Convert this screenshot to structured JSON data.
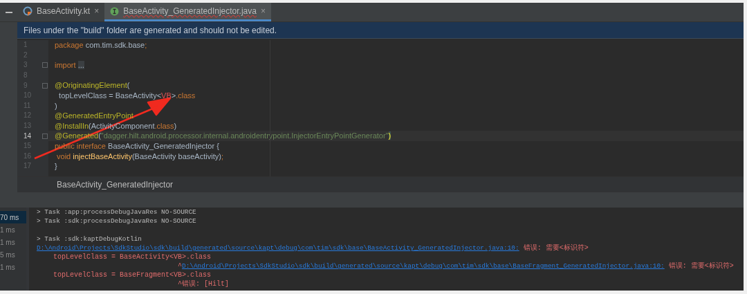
{
  "tabs": [
    {
      "label": "BaseActivity.kt",
      "kind": "kotlin",
      "selected": false,
      "error": false,
      "close": "×"
    },
    {
      "label": "BaseActivity_GeneratedInjector.java",
      "kind": "interface",
      "selected": true,
      "error": true,
      "close": "×"
    }
  ],
  "banner": "Files under the \"build\" folder are generated and should not be edited.",
  "code_lines": [
    {
      "number": "1",
      "fold": false,
      "current": false,
      "tokens": [
        {
          "text": "package ",
          "kind": "keyword"
        },
        {
          "text": "com.tim.sdk.base",
          "kind": "plain"
        },
        {
          "text": ";",
          "kind": "keyword"
        }
      ]
    },
    {
      "number": "2",
      "fold": false,
      "current": false
    },
    {
      "number": "3",
      "fold": true,
      "current": false,
      "tokens": [
        {
          "text": "import ",
          "kind": "keyword"
        },
        {
          "text": "...",
          "kind": "folded"
        }
      ]
    },
    {
      "number": "8",
      "fold": false,
      "current": false
    },
    {
      "number": "9",
      "fold": true,
      "current": false,
      "tokens": [
        {
          "text": "@OriginatingElement",
          "kind": "annotation"
        },
        {
          "text": "(",
          "kind": "plain"
        }
      ]
    },
    {
      "number": "10",
      "fold": false,
      "current": false,
      "tokens": [
        {
          "text": "  topLevelClass = BaseActivity<",
          "kind": "plain"
        },
        {
          "text": "VB",
          "kind": "error"
        },
        {
          "text": ">",
          "kind": "plain"
        },
        {
          "text": ".class",
          "kind": "keyword"
        }
      ]
    },
    {
      "number": "11",
      "fold": false,
      "current": false,
      "tokens": [
        {
          "text": ")",
          "kind": "plain"
        }
      ]
    },
    {
      "number": "12",
      "fold": false,
      "current": false,
      "tokens": [
        {
          "text": "@GeneratedEntryPoint",
          "kind": "annotation"
        }
      ]
    },
    {
      "number": "13",
      "fold": false,
      "current": false,
      "tokens": [
        {
          "text": "@InstallIn",
          "kind": "annotation"
        },
        {
          "text": "(ActivityComponent",
          "kind": "plain"
        },
        {
          "text": ".class",
          "kind": "keyword"
        },
        {
          "text": ")",
          "kind": "plain"
        }
      ]
    },
    {
      "number": "14",
      "fold": true,
      "current": true,
      "tokens": [
        {
          "text": "@Generated",
          "kind": "annotation"
        },
        {
          "text": "(",
          "kind": "plain"
        },
        {
          "text": "\"dagger.hilt.android.processor.internal.androidentrypoint.InjectorEntryPointGenerator\"",
          "kind": "string"
        },
        {
          "text": ")",
          "kind": "brace"
        }
      ]
    },
    {
      "number": "15",
      "fold": false,
      "current": false,
      "tokens": [
        {
          "text": "public interface ",
          "kind": "keyword"
        },
        {
          "text": "BaseActivity_GeneratedInjector {",
          "kind": "plain"
        }
      ]
    },
    {
      "number": "16",
      "fold": false,
      "current": false,
      "tokens": [
        {
          "text": " void ",
          "kind": "keyword"
        },
        {
          "text": "injectBaseActivity",
          "kind": "method"
        },
        {
          "text": "(BaseActivity baseActivity)",
          "kind": "plain"
        },
        {
          "text": ";",
          "kind": "keyword"
        }
      ]
    },
    {
      "number": "17",
      "fold": false,
      "current": false,
      "tokens": [
        {
          "text": "}",
          "kind": "plain"
        }
      ]
    }
  ],
  "breadcrumb": "BaseActivity_GeneratedInjector",
  "build_times": [
    {
      "text": "70 ms",
      "selected": true
    },
    {
      "text": "1 ms",
      "selected": false
    },
    {
      "text": "1 ms",
      "selected": false
    },
    {
      "text": "5 ms",
      "selected": false
    },
    {
      "text": "1 ms",
      "selected": false
    }
  ],
  "console_lines": [
    {
      "tokens": [
        {
          "text": "> Task :app:processDebugJavaRes NO-SOURCE",
          "kind": "plain"
        }
      ]
    },
    {
      "tokens": [
        {
          "text": "> Task :sdk:processDebugJavaRes NO-SOURCE",
          "kind": "plain"
        }
      ]
    },
    {
      "kind": "blank"
    },
    {
      "tokens": [
        {
          "text": "> Task :sdk:kaptDebugKotlin",
          "kind": "plain"
        }
      ]
    },
    {
      "tokens": [
        {
          "text": "D:\\Android\\Projects\\SdkStudio\\sdk\\build\\generated\\source\\kapt\\debug\\com\\tim\\sdk\\base\\BaseActivity_GeneratedInjector.java:10:",
          "kind": "link"
        },
        {
          "text": " 错误: 需要<标识符>",
          "kind": "error"
        }
      ]
    },
    {
      "tokens": [
        {
          "text": "    topLevelClass = BaseActivity<VB>.class",
          "kind": "error"
        }
      ]
    },
    {
      "tokens": [
        {
          "text": "                                  ^",
          "kind": "error"
        },
        {
          "text": "D:\\Android\\Projects\\SdkStudio\\sdk\\build\\generated\\source\\kapt\\debug\\com\\tim\\sdk\\base\\BaseFragment_GeneratedInjector.java:10:",
          "kind": "link"
        },
        {
          "text": " 错误: 需要<标识符>",
          "kind": "error"
        }
      ]
    },
    {
      "tokens": [
        {
          "text": "    topLevelClass = BaseFragment<VB>.class",
          "kind": "error"
        }
      ]
    },
    {
      "tokens": [
        {
          "text": "                                  ^错误: [Hilt]",
          "kind": "error"
        }
      ]
    }
  ]
}
